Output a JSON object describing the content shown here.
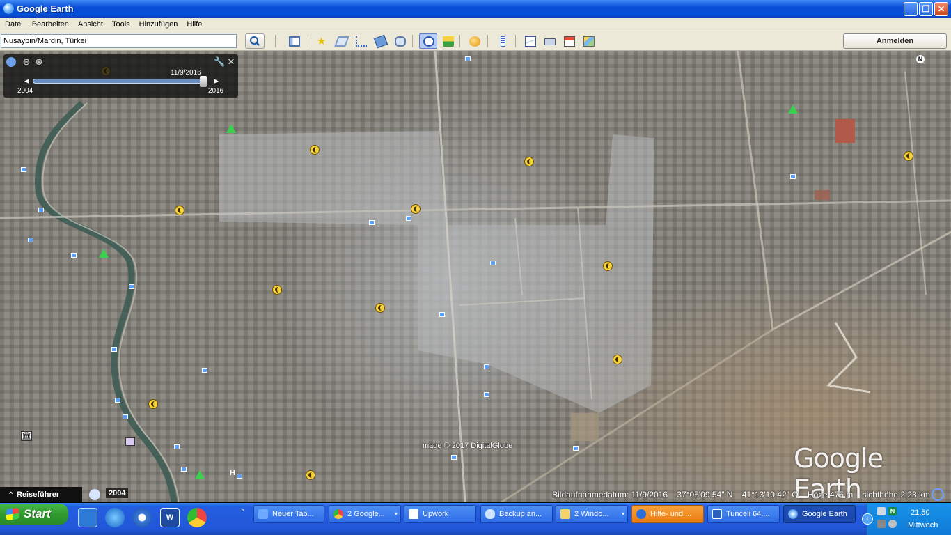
{
  "window": {
    "title": "Google Earth",
    "minimize": "_",
    "maximize": "❐",
    "close": "✕"
  },
  "menu": [
    "Datei",
    "Bearbeiten",
    "Ansicht",
    "Tools",
    "Hinzufügen",
    "Hilfe"
  ],
  "search": {
    "value": "Nusaybin/Mardin, Türkei"
  },
  "toolbar": {
    "login_label": "Anmelden"
  },
  "time_slider": {
    "current_date": "11/9/2016",
    "start_year": "2004",
    "end_year": "2016",
    "position": 1.0
  },
  "compass_label": "N",
  "map": {
    "imagery_credit": "mage © 2017 DigitalGlobe",
    "logo_text": "Google Earth"
  },
  "statusbar": {
    "tour_guide": "Reiseführer",
    "year_badge": "2004",
    "imagery_date": "Bildaufnahmedatum: 11/9/2016",
    "lat": "37°05'09.54\" N",
    "lon": "41°13'10.42\" O",
    "elevation": "Höhe  475 m",
    "eye_alt": "sichthöhe   2.23 km"
  },
  "taskbar": {
    "start_label": "Start",
    "tasks": [
      {
        "label": "Neuer Tab...",
        "color": "#6fa8ff",
        "arrow": ""
      },
      {
        "label": "2 Google...",
        "color": "#e8c23a",
        "arrow": "▾"
      },
      {
        "label": "Upwork",
        "color": "#ffffff",
        "arrow": ""
      },
      {
        "label": "Backup an...",
        "color": "#cfe3ff",
        "arrow": ""
      },
      {
        "label": "2 Windo...",
        "color": "#f3d36a",
        "arrow": "▾"
      },
      {
        "label": "Hilfe- und ...",
        "color": "#2a6fe0",
        "arrow": ""
      },
      {
        "label": "Tunceli 64....",
        "color": "#2c5fb8",
        "arrow": ""
      },
      {
        "label": "Google Earth",
        "color": "#8fc4ff",
        "arrow": ""
      }
    ],
    "clock": "21:50",
    "day": "Mittwoch"
  },
  "colors": {
    "titlebar": "#0a4ed8",
    "chrome": "#ece9d8",
    "taskbar": "#245ee0",
    "start": "#2f9a2e",
    "poi": "#f7d23b",
    "park": "#3ad14e"
  }
}
